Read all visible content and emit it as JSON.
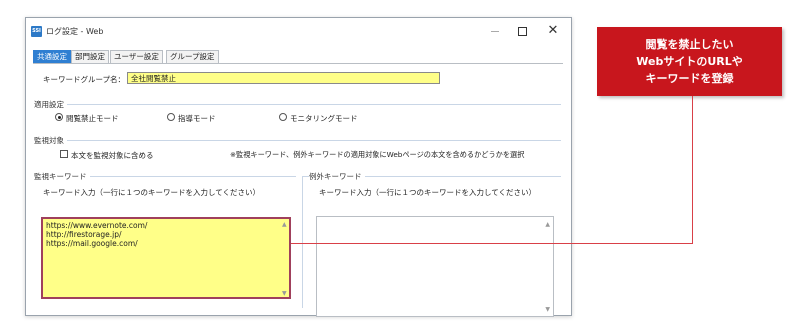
{
  "window": {
    "app_icon_text": "SSI",
    "title": "ログ設定 - Web",
    "minimize_icon": "minimize-icon",
    "maximize_icon": "maximize-icon",
    "close_icon": "close-icon",
    "close_glyph": "✕"
  },
  "tabs": [
    {
      "label": "共通設定",
      "active": true
    },
    {
      "label": "部門設定",
      "active": false
    },
    {
      "label": "ユーザー設定",
      "active": false
    },
    {
      "label": "グループ設定",
      "active": false
    }
  ],
  "keyword_group": {
    "label": "キーワードグループ名：",
    "value": "全社閲覧禁止"
  },
  "apply_settings": {
    "title": "適用設定",
    "options": [
      "閲覧禁止モード",
      "指導モード",
      "モニタリングモード"
    ],
    "selected": "閲覧禁止モード"
  },
  "monitoring_target": {
    "title": "監視対象",
    "checkbox_label": "本文を監視対象に含める",
    "checked": false,
    "note": "※監視キーワード、例外キーワードの適用対象にWebページの本文を含めるかどうかを選択"
  },
  "monitor_keywords": {
    "title": "監視キーワード",
    "input_label": "キーワード入力（一行に１つのキーワードを入力してください）",
    "value": "https://www.evernote.com/\nhttp://firestorage.jp/\nhttps://mail.google.com/"
  },
  "exception_keywords": {
    "title": "例外キーワード",
    "input_label": "キーワード入力（一行に１つのキーワードを入力してください）",
    "value": ""
  },
  "callout": {
    "lines": [
      "閲覧を禁止したい",
      "WebサイトのURLや",
      "キーワードを登録"
    ],
    "color": "#c8161d"
  }
}
